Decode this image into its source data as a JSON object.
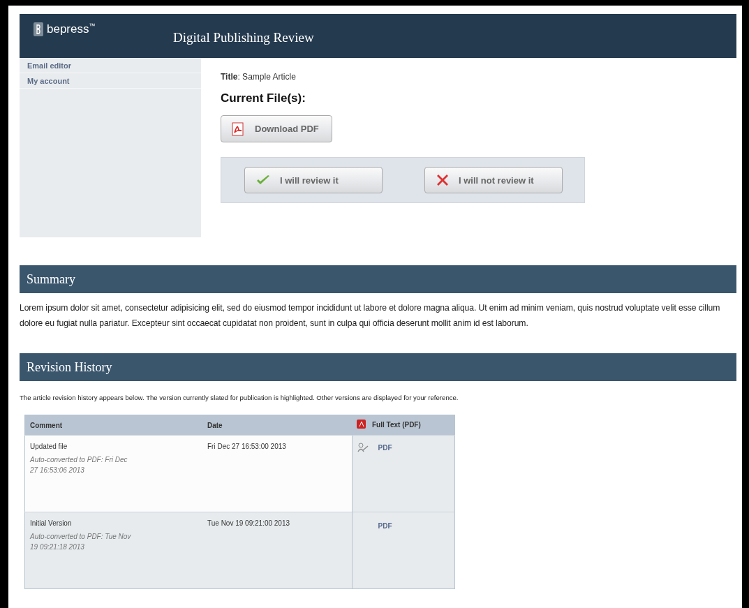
{
  "header": {
    "logo": "bepress",
    "trademark": "™",
    "title": "Digital Publishing Review"
  },
  "sidebar": {
    "items": [
      {
        "label": "Email editor"
      },
      {
        "label": "My account"
      }
    ]
  },
  "article": {
    "title_label": "Title",
    "title_value": ": Sample Article",
    "files_heading": "Current File(s):",
    "download_button": "Download PDF",
    "review_buttons": [
      {
        "kind": "accept",
        "label": "I will review it"
      },
      {
        "kind": "decline",
        "label": "I will not review it"
      }
    ]
  },
  "summary": {
    "heading": "Summary",
    "text": "Lorem ipsum dolor sit amet, consectetur adipisicing elit, sed do eiusmod tempor incididunt ut labore et dolore magna aliqua. Ut enim ad minim veniam, quis nostrud voluptate velit esse cillum dolore eu fugiat nulla pariatur. Excepteur sint occaecat cupidatat non proident, sunt in culpa qui officia deserunt mollit anim id est laborum."
  },
  "revision_history": {
    "heading": "Revision History",
    "intro": "The article revision history appears below. The version currently slated for publication is highlighted. Other versions are displayed for your reference.",
    "table": {
      "columns": [
        "Comment",
        "Date",
        "Full Text (PDF)"
      ],
      "rows": [
        {
          "comment": "Updated file",
          "note": "Auto-converted to PDF: Fri Dec 27 16:53:06 2013",
          "date": "Fri Dec 27 16:53:00 2013",
          "link": "PDF",
          "highlighted": false,
          "reviewer_icon": true
        },
        {
          "comment": "Initial Version",
          "note": "Auto-converted to PDF: Tue Nov 19 09:21:18 2013",
          "date": "Tue Nov 19 09:21:00 2013",
          "link": "PDF",
          "highlighted": true,
          "reviewer_icon": false
        }
      ]
    }
  }
}
